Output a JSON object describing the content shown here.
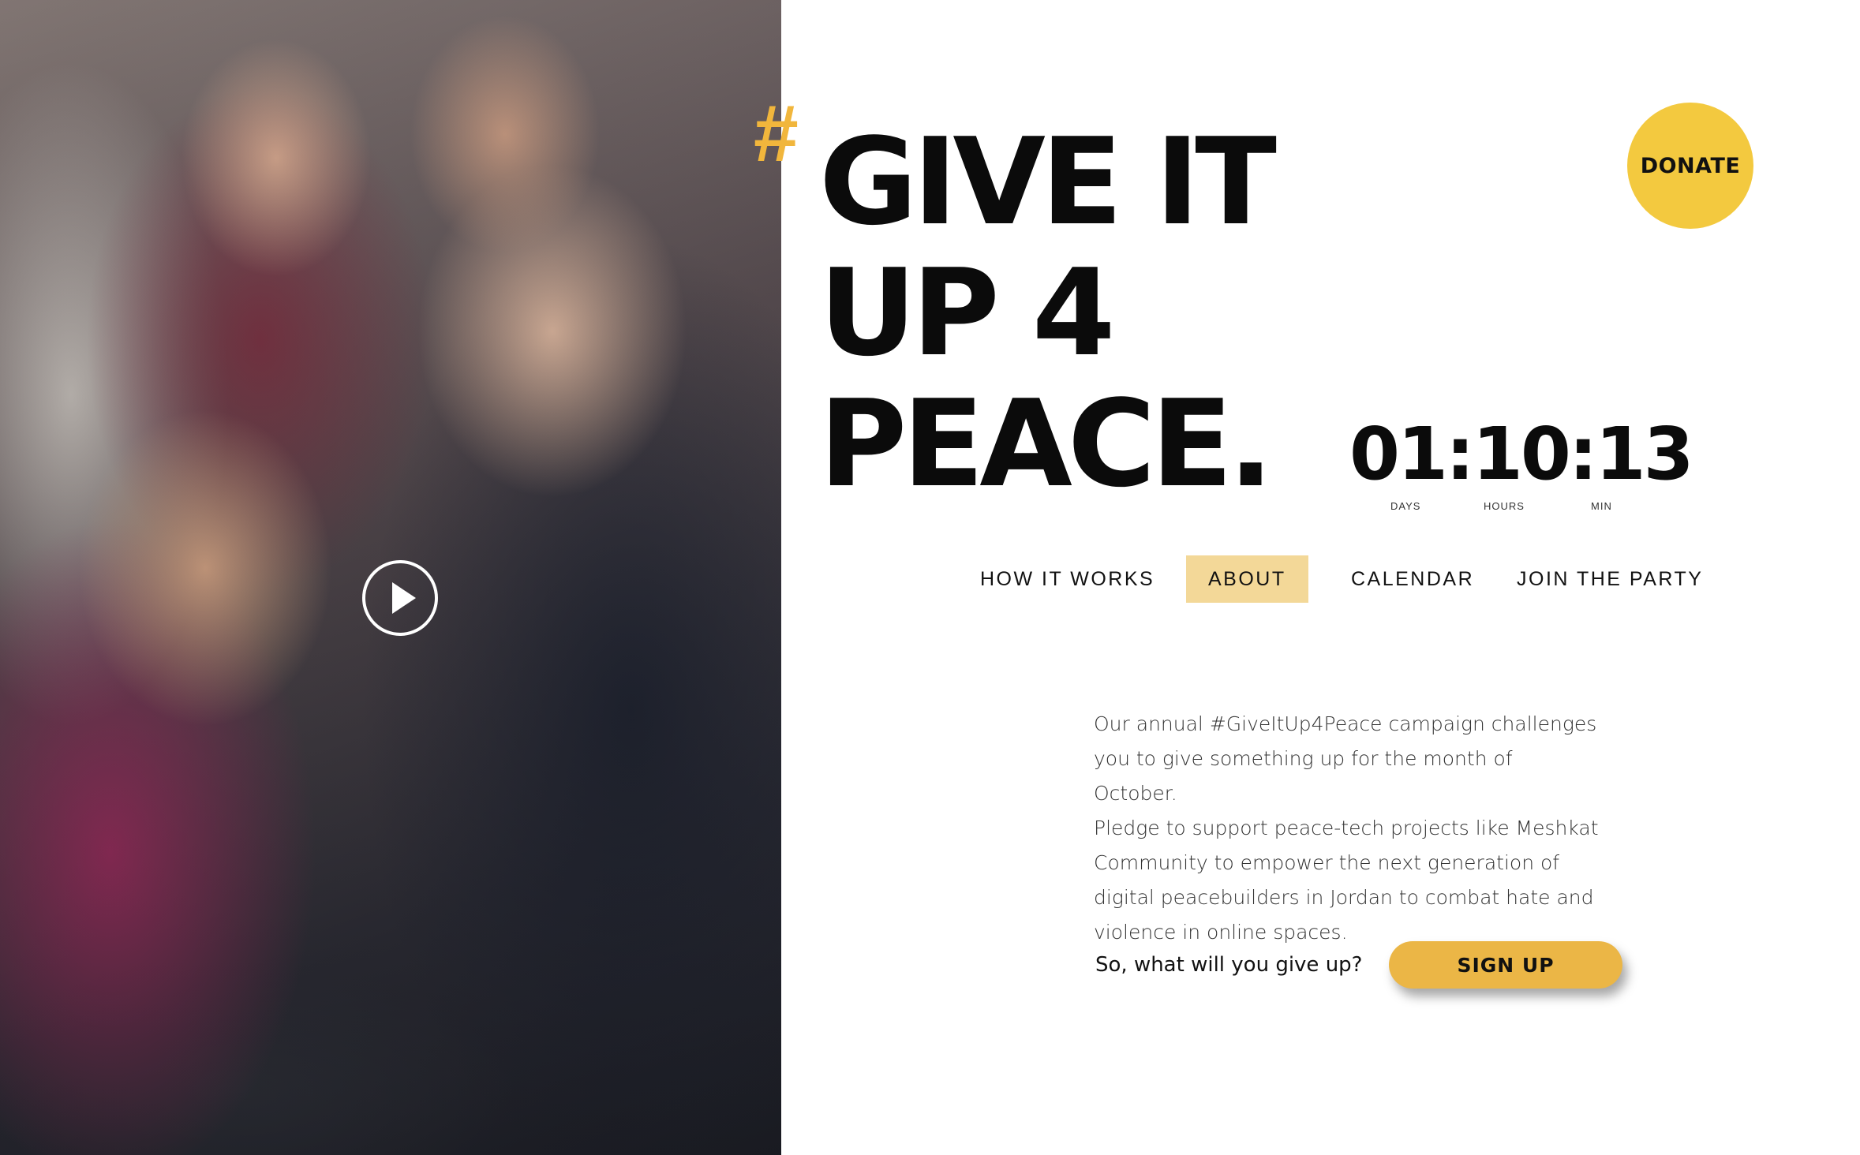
{
  "hero": {
    "image_alt": "",
    "play_icon": "play-icon"
  },
  "headline": {
    "hash": "#",
    "lines": [
      "GIVE IT",
      "UP 4",
      "PEACE."
    ]
  },
  "countdown": {
    "value": "01:10:13",
    "units": [
      "DAYS",
      "HOURS",
      "MIN"
    ]
  },
  "donate": {
    "label": "DONATE",
    "color": "#f3c93f"
  },
  "nav": {
    "items": [
      {
        "label": "HOW IT WORKS",
        "active": false
      },
      {
        "label": "ABOUT",
        "active": true
      },
      {
        "label": "CALENDAR",
        "active": false
      },
      {
        "label": "JOIN THE PARTY",
        "active": false
      }
    ],
    "active_color": "#f3d898"
  },
  "about": {
    "lines": [
      "Our annual #GiveItUp4Peace campaign challenges",
      "you to give something up for the month of October.",
      "Pledge to support peace-tech projects like Meshkat",
      "Community to empower the next generation of",
      "digital peacebuilders in Jordan to combat hate and",
      "violence in online spaces."
    ]
  },
  "cta": {
    "question": "So, what will you give up?",
    "button_label": "SIGN UP",
    "button_color": "#ebb646"
  },
  "colors": {
    "accent": "#f1b63c",
    "text": "#0b0b0b"
  }
}
